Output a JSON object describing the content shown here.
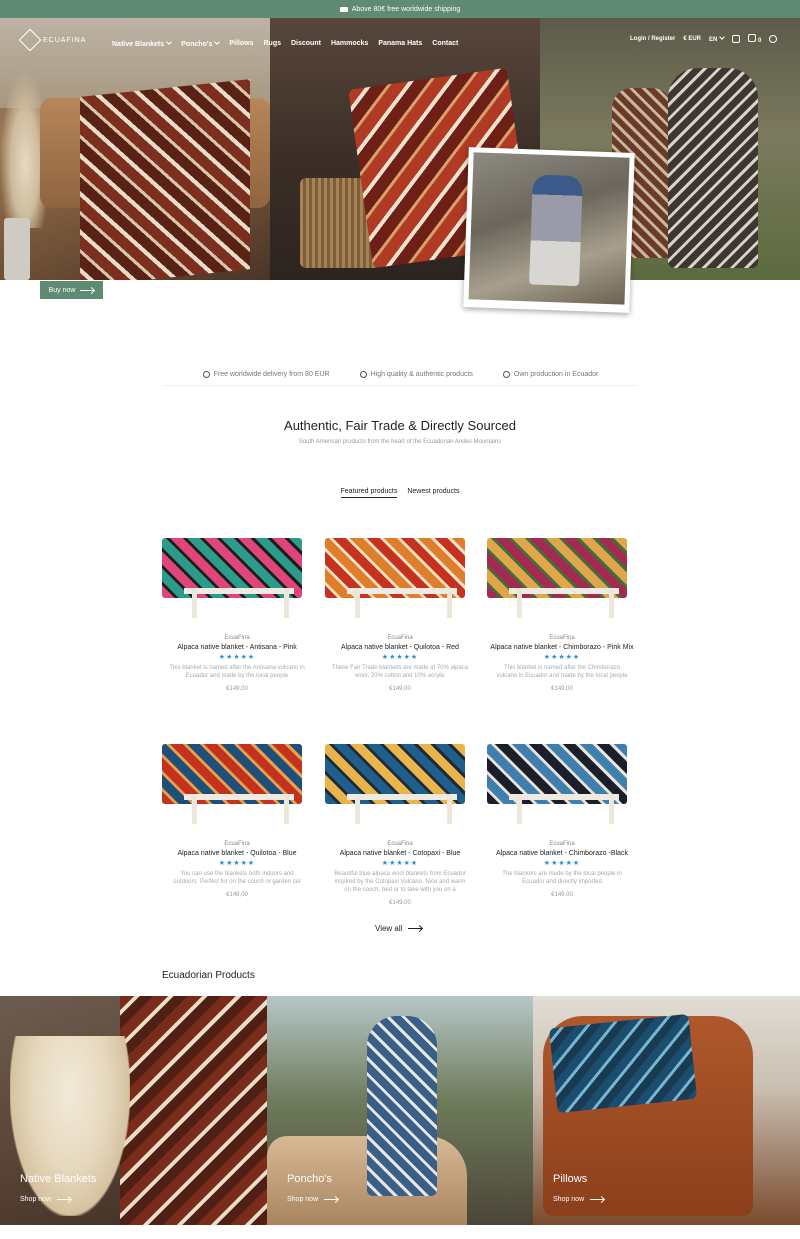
{
  "topbar": {
    "text": "Above 80€ free worldwide shipping"
  },
  "nav": {
    "logo": "ECUAFINA",
    "menu": [
      "Native Blankets",
      "Poncho's",
      "Pillows",
      "Rugs",
      "Discount",
      "Hammocks",
      "Panama Hats",
      "Contact"
    ],
    "login": "Login / Register",
    "currency": "€ EUR",
    "language": "EN",
    "cart_count": "0"
  },
  "hero": {
    "buy_now": "Buy now"
  },
  "features": [
    "Free worldwide delivery from 80 EUR",
    "High quality & authentic products",
    "Own production in Ecuador"
  ],
  "section": {
    "title": "Authentic, Fair Trade & Directly Sourced",
    "subtitle": "South American products from the heart of the Ecuadorian Andes Mountains"
  },
  "tabs": [
    "Featured products",
    "Newest products"
  ],
  "products": [
    {
      "brand": "EcuaFina",
      "name": "Alpaca native blanket - Antisana - Pink",
      "stars": "★★★★★",
      "desc": "This blanket is named after the Antisana vulcano in Ecuador and made by the local people",
      "price": "€149,00",
      "c1": "#e0457a",
      "c2": "#2d9b8c",
      "c3": "#1d1d1d"
    },
    {
      "brand": "EcuaFina",
      "name": "Alpaca native blanket - Quilotoa - Red",
      "stars": "★★★★★",
      "desc": "These Fair Trade blankets are made of 70% alpaca wool, 20% cotton and 10% acrylic",
      "price": "€149,00",
      "c1": "#c7321f",
      "c2": "#e07d2a",
      "c3": "#f1e2c6"
    },
    {
      "brand": "EcuaFina",
      "name": "Alpaca native blanket - Chimborazo - Pink Mix",
      "stars": "★★★★★",
      "desc": "This blanket is named after the Chimborazo vulcano in Ecuador and made by the local people",
      "price": "€149,00",
      "c1": "#a42a52",
      "c2": "#e2a64a",
      "c3": "#3f6f3d"
    },
    {
      "brand": "EcuaFina",
      "name": "Alpaca native blanket - Quilotoa - Blue",
      "stars": "★★★★★",
      "desc": "You can use the blankets both indoors and outdoors. Perfect for on the couch or garden set",
      "price": "€149,00",
      "c1": "#c2321f",
      "c2": "#1d4f7a",
      "c3": "#e7a14a"
    },
    {
      "brand": "EcuaFina",
      "name": "Alpaca native blanket - Cotopaxi - Blue",
      "stars": "★★★★★",
      "desc": "Beautiful blue alpaca wool blankets from Ecuador inspired by the Cotopaxi Vulcano. Nice and warm on the couch, bed or to take with you on a",
      "price": "€149,00",
      "c1": "#1f5f8c",
      "c2": "#e9b54a",
      "c3": "#1c2a3a"
    },
    {
      "brand": "EcuaFina",
      "name": "Alpaca native blanket - Chimborazo -Black",
      "stars": "★★★★★",
      "desc": "The blankets are made by the local people in Ecuador and directly imported",
      "price": "€149,00",
      "c1": "#1a1f2b",
      "c2": "#3f7fb0",
      "c3": "#e8e3d6"
    }
  ],
  "view_all": "View all",
  "ecua_title": "Ecuadorian Products",
  "categories": [
    {
      "label": "Native Blankets",
      "shop": "Shop now"
    },
    {
      "label": "Poncho's",
      "shop": "Shop now"
    },
    {
      "label": "Pillows",
      "shop": "Shop now"
    }
  ]
}
